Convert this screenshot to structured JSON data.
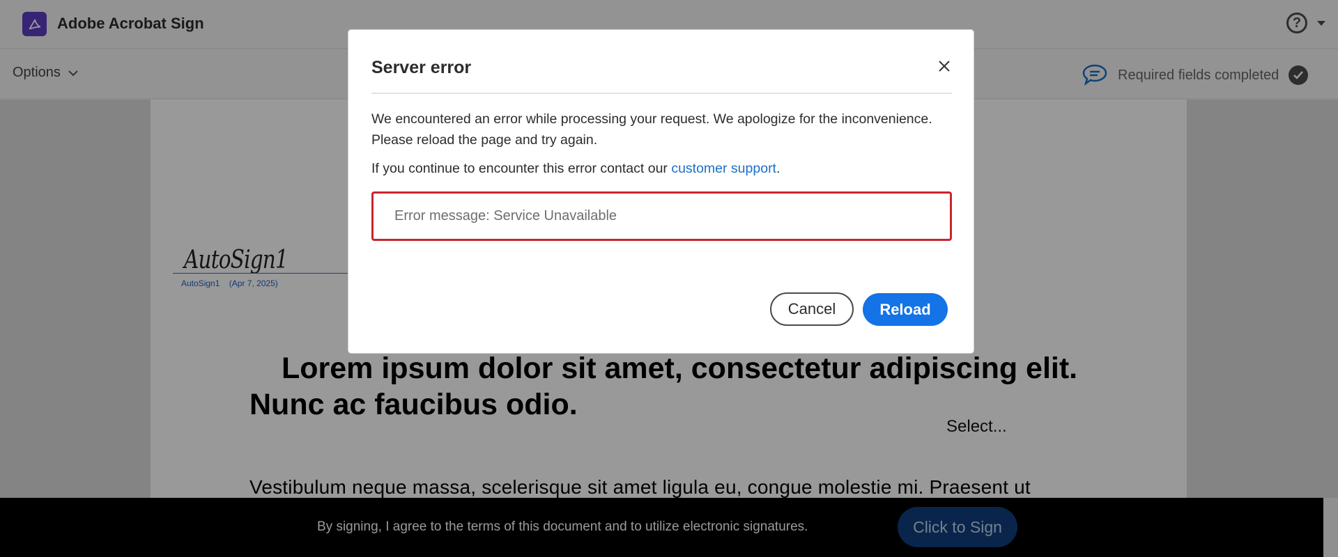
{
  "header": {
    "app_title": "Adobe Acrobat Sign",
    "logo_icon": "acrobat-logo-icon",
    "help_icon": "help-circle-icon"
  },
  "toolbar": {
    "options_label": "Options",
    "required_status": "Required fields completed"
  },
  "document": {
    "signature_name": "AutoSign1",
    "signature_caption_name": "AutoSign1",
    "signature_caption_date": "(Apr 7, 2025)",
    "heading": "Lorem ipsum dolor sit amet, consectetur adipiscing elit. Nunc ac faucibus odio.",
    "select_label": "Select...",
    "paragraph": "Vestibulum neque massa, scelerisque sit amet ligula eu, congue molestie mi. Praesent ut"
  },
  "footer": {
    "agreement_text": "By signing, I agree to the terms of this document and to utilize electronic signatures.",
    "sign_button": "Click to Sign"
  },
  "modal": {
    "title": "Server error",
    "message": "We encountered an error while processing your request. We apologize for the inconvenience. Please reload the page and try again.",
    "support_prefix": "If you continue to encounter this error contact our ",
    "support_link": "customer support",
    "support_suffix": ".",
    "error_message": "Error message: Service Unavailable",
    "cancel_label": "Cancel",
    "reload_label": "Reload"
  },
  "colors": {
    "accent": "#1473e6",
    "error_border": "#c9252d",
    "link": "#1a6fc9",
    "logo_bg": "#5c3cc4"
  }
}
